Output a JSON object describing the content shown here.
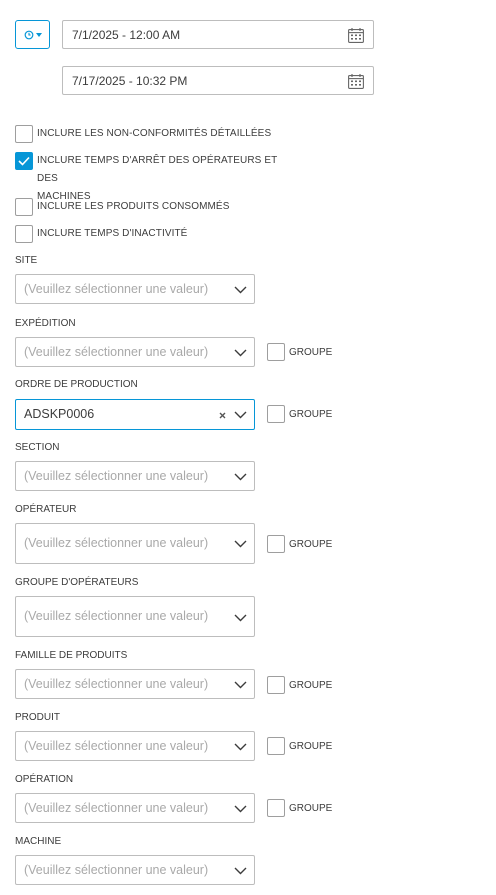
{
  "date_range": {
    "start": "7/1/2025 - 12:00 AM",
    "end": "7/17/2025 - 10:32 PM"
  },
  "options": [
    {
      "label": "INCLURE LES NON-CONFORMITÉS DÉTAILLÉES",
      "checked": false
    },
    {
      "label_line1": "INCLURE TEMPS D'ARRÊT DES OPÉRATEURS ET DES",
      "label_line2": "MACHINES",
      "checked": true
    },
    {
      "label": "INCLURE LES PRODUITS CONSOMMÉS",
      "checked": false
    },
    {
      "label": "INCLURE TEMPS D'INACTIVITÉ",
      "checked": false
    }
  ],
  "placeholder": "(Veuillez sélectionner une valeur)",
  "group_label": "GROUPE",
  "fields": {
    "site": {
      "label": "SITE"
    },
    "expedition": {
      "label": "EXPÉDITION"
    },
    "ordre": {
      "label": "ORDRE DE PRODUCTION",
      "value": "ADSKP0006"
    },
    "section": {
      "label": "SECTION"
    },
    "operateur": {
      "label": "OPÉRATEUR"
    },
    "groupe_operateurs": {
      "label": "GROUPE D'OPÉRATEURS"
    },
    "famille": {
      "label": "FAMILLE DE PRODUITS"
    },
    "produit": {
      "label": "PRODUIT"
    },
    "operation": {
      "label": "OPÉRATION"
    },
    "machine": {
      "label": "MACHINE"
    }
  },
  "colors": {
    "accent": "#0696d7",
    "border": "#bdbdbd",
    "placeholder": "#a9a9a9"
  }
}
